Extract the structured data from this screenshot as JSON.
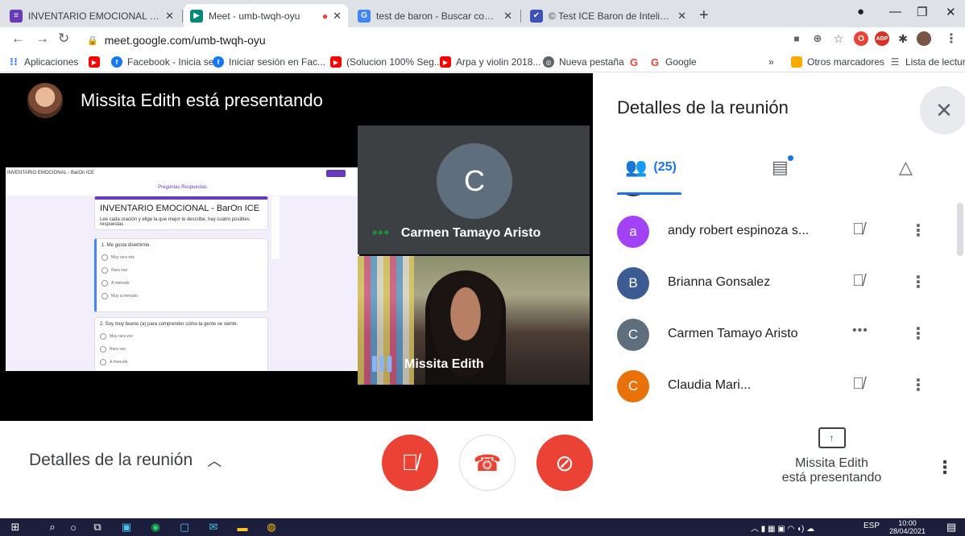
{
  "browser": {
    "tabs": [
      {
        "title": "INVENTARIO EMOCIONAL - BarC",
        "favicon_color": "#673ab7"
      },
      {
        "title": "Meet - umb-twqh-oyu",
        "favicon_color": "#00897b"
      },
      {
        "title": "test de baron - Buscar con Googl",
        "favicon_color": "#4285f4"
      },
      {
        "title": "© Test ICE Baron de Inteligencia",
        "favicon_color": "#3f51b5"
      }
    ],
    "url": "meet.google.com/umb-twqh-oyu",
    "bookmarks": [
      "Aplicaciones",
      "Facebook - Inicia se...",
      "Iniciar sesión en Fac...",
      "(Solucion 100% Seg...",
      "Arpa y violin 2018...",
      "Nueva pestaña",
      "Google"
    ],
    "bookmarks_more": "»",
    "other_bookmarks": "Otros marcadores",
    "reading_list": "Lista de lectura"
  },
  "meet": {
    "presenter_banner": "Missita Edith está presentando",
    "shared_screen": {
      "topbar_title": "INVENTARIO EMOCIONAL - BarOn ICE",
      "tabs_label": "Preguntas  Respuestas",
      "form_title": "INVENTARIO EMOCIONAL - BarOn ICE",
      "form_desc": "Lee cada oración y elige la que mejor te describe, hay cuatro posibles respuestas",
      "q1": "1. Me gusta divertirme.",
      "q2": "2. Soy muy bueno (a) para comprender cómo la gente se siente.",
      "options": [
        "Muy rara vez",
        "Rara vez",
        "A menudo",
        "Muy a menudo"
      ]
    },
    "tiles": [
      {
        "name": "Carmen Tamayo Aristo",
        "initial": "C"
      },
      {
        "name": "Missita Edith"
      }
    ],
    "panel": {
      "title": "Detalles de la reunión",
      "people_count": "(25)",
      "participants": [
        {
          "initial": "a",
          "name": "andy robert espinoza s...",
          "color": "#a142f4",
          "status": "muted"
        },
        {
          "initial": "B",
          "name": "Brianna Gonsalez",
          "color": "#3b5b92",
          "status": "muted"
        },
        {
          "initial": "C",
          "name": "Carmen Tamayo Aristo",
          "color": "#5f6e7c",
          "status": "speaking"
        },
        {
          "initial": "C",
          "name": "Claudia Mari...",
          "color": "#e8710a",
          "status": "muted"
        }
      ]
    },
    "bottom": {
      "details_label": "Detalles de la reunión",
      "presenting_line1": "Missita Edith",
      "presenting_line2": "está presentando"
    }
  },
  "taskbar": {
    "lang": "ESP",
    "time": "10:00",
    "date": "28/04/2021"
  }
}
